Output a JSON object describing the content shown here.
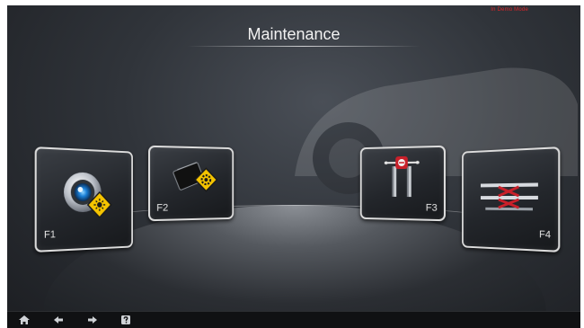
{
  "header": {
    "title": "Maintenance",
    "mode_label": "In Demo Mode"
  },
  "tiles": [
    {
      "key": "F1",
      "label": "F1",
      "icon": "camera-calibration-icon"
    },
    {
      "key": "F2",
      "label": "F2",
      "icon": "target-settings-icon"
    },
    {
      "key": "F3",
      "label": "F3",
      "icon": "lift-post-icon"
    },
    {
      "key": "F4",
      "label": "F4",
      "icon": "scissor-lift-icon"
    }
  ],
  "bottom_nav": [
    {
      "icon": "home-icon"
    },
    {
      "icon": "back-arrow-icon"
    },
    {
      "icon": "forward-arrow-icon"
    },
    {
      "icon": "help-icon"
    }
  ],
  "colors": {
    "mode_label": "#d9262a",
    "accent_yellow": "#f5c400"
  }
}
